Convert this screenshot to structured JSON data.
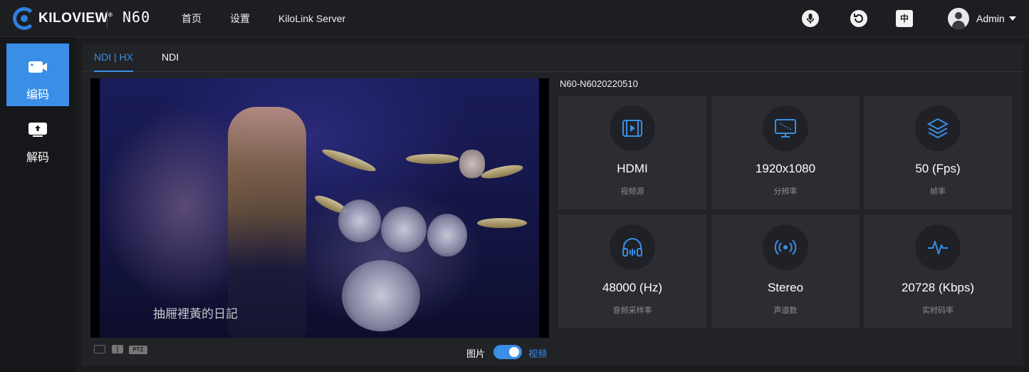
{
  "brand": {
    "name": "KILOVIEW",
    "reg": "®",
    "model": "N60"
  },
  "nav": {
    "home": "首页",
    "settings": "设置",
    "server": "KiloLink Server"
  },
  "topbar": {
    "lang_label": "中",
    "user": "Admin"
  },
  "sidebar": {
    "items": [
      {
        "label": "编码",
        "active": true
      },
      {
        "label": "解码",
        "active": false
      }
    ]
  },
  "tabs": [
    {
      "label": "NDI | HX",
      "active": true
    },
    {
      "label": "NDI",
      "active": false
    }
  ],
  "video": {
    "caption": "抽屜裡黃的日記",
    "controls": {
      "ptz_label": "PTZ",
      "left_label": "图片",
      "right_label": "视频",
      "toggle_on": true
    }
  },
  "device": {
    "name": "N60-N6020220510"
  },
  "stats": [
    {
      "value": "HDMI",
      "label": "视频源",
      "icon": "video-source-icon"
    },
    {
      "value": "1920x1080",
      "label": "分辨率",
      "icon": "monitor-icon"
    },
    {
      "value": "50 (Fps)",
      "label": "帧率",
      "icon": "layers-icon"
    },
    {
      "value": "48000 (Hz)",
      "label": "音频采样率",
      "icon": "headphones-icon"
    },
    {
      "value": "Stereo",
      "label": "声道数",
      "icon": "broadcast-icon"
    },
    {
      "value": "20728 (Kbps)",
      "label": "实时码率",
      "icon": "pulse-icon"
    }
  ],
  "colors": {
    "accent": "#3a8ee6",
    "card": "#2c2d32",
    "panel": "#222327"
  }
}
